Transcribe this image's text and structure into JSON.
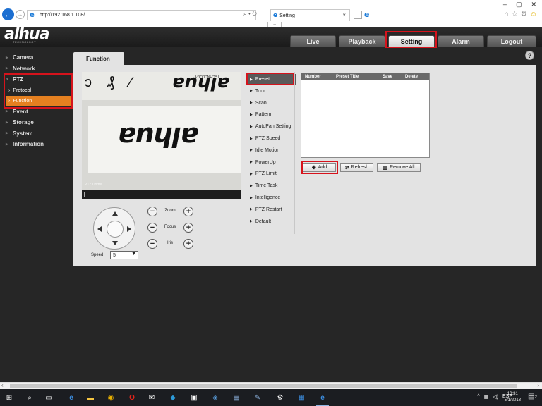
{
  "browser": {
    "url": "http://192.168.1.108/",
    "tab_title": "Setting",
    "tab_close": "×",
    "address_tools": "⌕ ▾ ↻",
    "window_controls": [
      "–",
      "▢",
      "✕"
    ],
    "toolbar_icons": [
      "home-icon",
      "star-icon",
      "gear-icon",
      "smiley-icon"
    ]
  },
  "app": {
    "logo": "alhua",
    "logo_sub": "TECHNOLOGY",
    "top_tabs": [
      "Live",
      "Playback",
      "Setting",
      "Alarm",
      "Logout"
    ],
    "active_top_tab": "Setting"
  },
  "sidebar": {
    "items": [
      {
        "label": "Camera"
      },
      {
        "label": "Network"
      },
      {
        "label": "PTZ",
        "expanded": true
      },
      {
        "label": "Event"
      },
      {
        "label": "Storage"
      },
      {
        "label": "System"
      },
      {
        "label": "Information"
      }
    ],
    "ptz_sub": [
      "Protocol",
      "Function"
    ],
    "active_sub": "Function"
  },
  "panel": {
    "tab": "Function",
    "help": "?"
  },
  "video": {
    "osd_bottom": "PTZ Dome",
    "brand_text": "alhua"
  },
  "controls": {
    "zoom": "Zoom",
    "focus": "Focus",
    "iris": "Iris",
    "minus": "−",
    "plus": "+",
    "speed_label": "Speed",
    "speed_value": "5"
  },
  "ptz_menu": {
    "items": [
      "Preset",
      "Tour",
      "Scan",
      "Pattern",
      "AutoPan Setting",
      "PTZ Speed",
      "Idle Motion",
      "PowerUp",
      "PTZ Limit",
      "Time Task",
      "Intelligence",
      "PTZ Restart",
      "Default"
    ],
    "active": "Preset"
  },
  "preset_table": {
    "columns": [
      "Number",
      "Preset Title",
      "Save",
      "Delete"
    ],
    "rows": []
  },
  "buttons": {
    "add": "Add",
    "refresh": "Refresh",
    "remove_all": "Remove All"
  },
  "taskbar": {
    "language": "ESP",
    "time": "10:31",
    "date": "5/1/2018",
    "notifications": "2"
  },
  "colors": {
    "highlight": "#d6131c",
    "active_sub_bg": "#e58020",
    "app_bg": "#262626",
    "panel_bg": "#e3e3e3"
  }
}
